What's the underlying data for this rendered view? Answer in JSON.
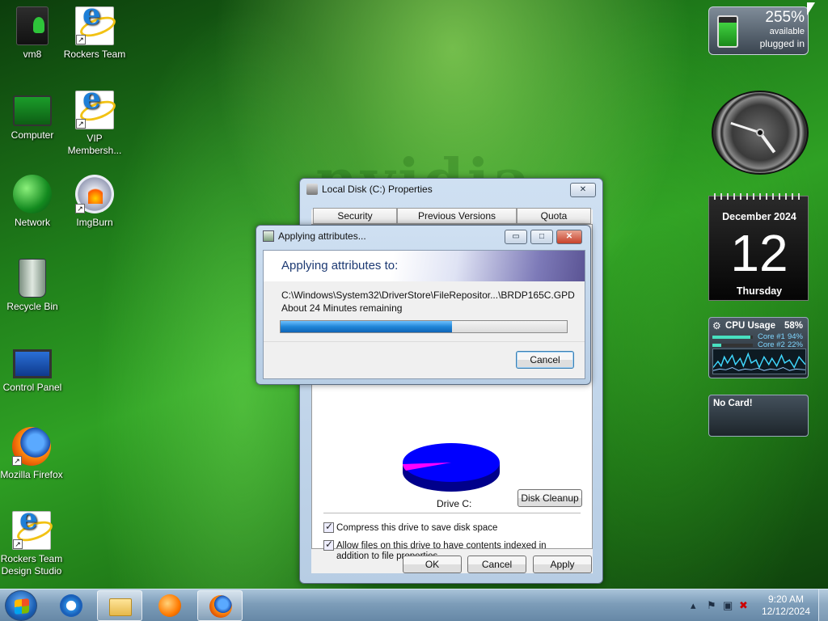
{
  "desktop": {
    "watermark": "nvidia",
    "icons": [
      {
        "label": "vm8",
        "icon": "vm-icon"
      },
      {
        "label": "Rockers Team",
        "icon": "internet-explorer-icon"
      },
      {
        "label": "Computer",
        "icon": "computer-icon"
      },
      {
        "label": "VIP Membersh...",
        "icon": "internet-explorer-icon"
      },
      {
        "label": "Network",
        "icon": "network-icon"
      },
      {
        "label": "ImgBurn",
        "icon": "imgburn-icon"
      },
      {
        "label": "Recycle Bin",
        "icon": "recycle-bin-icon"
      },
      {
        "label": "Control Panel",
        "icon": "control-panel-icon"
      },
      {
        "label": "Mozilla Firefox",
        "icon": "firefox-icon"
      },
      {
        "label": "Rockers Team Design Studio",
        "icon": "internet-explorer-icon"
      }
    ]
  },
  "gadgets": {
    "battery": {
      "percent": "255%",
      "line1": "available",
      "line2": "plugged in"
    },
    "clock": {
      "hour": 4,
      "minute": 48
    },
    "calendar": {
      "month": "December 2024",
      "day": "12",
      "weekday": "Thursday"
    },
    "cpu": {
      "title": "CPU Usage",
      "total": "58%",
      "cores": [
        {
          "label": "Core #1",
          "value": "94%",
          "fraction": 0.94
        },
        {
          "label": "Core #2",
          "value": "22%",
          "fraction": 0.22
        }
      ]
    },
    "gpu": {
      "title": "No Card!"
    }
  },
  "properties_dialog": {
    "title": "Local Disk (C:) Properties",
    "tabs": [
      "Security",
      "Previous Versions",
      "Quota"
    ],
    "drive_label": "Drive C:",
    "disk_cleanup": "Disk Cleanup",
    "compress_label": "Compress this drive to save disk space",
    "index_label": "Allow files on this drive to have contents indexed in addition to file properties",
    "buttons": {
      "ok": "OK",
      "cancel": "Cancel",
      "apply": "Apply"
    },
    "colors": {
      "used": "#0000ff",
      "free": "#ff00ff"
    }
  },
  "apply_dialog": {
    "title": "Applying attributes...",
    "heading": "Applying attributes to:",
    "path": "C:\\Windows\\System32\\DriverStore\\FileRepositor...\\BRDP165C.GPD",
    "remaining": "About 24 Minutes remaining",
    "progress": 0.6,
    "cancel": "Cancel",
    "controls": {
      "minimize": "▭",
      "maximize": "□",
      "close": "✕"
    }
  },
  "taskbar": {
    "items": [
      {
        "name": "internet-explorer",
        "active": false
      },
      {
        "name": "windows-explorer",
        "active": true
      },
      {
        "name": "media-player",
        "active": false
      },
      {
        "name": "firefox",
        "active": true
      }
    ],
    "tray": {
      "time": "9:20 AM",
      "date": "12/12/2024"
    }
  }
}
